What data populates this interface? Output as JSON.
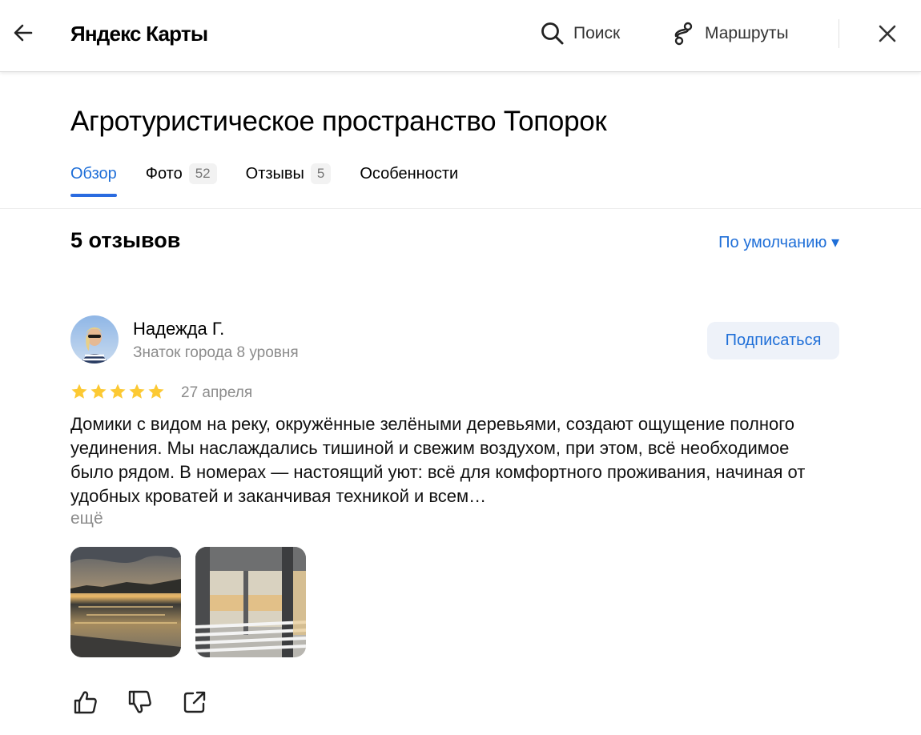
{
  "header": {
    "logo": "Яндекс Карты",
    "back_icon": "arrow-left-icon",
    "search_label": "Поиск",
    "routes_label": "Маршруты",
    "close_icon": "close-icon"
  },
  "organization": {
    "title": "Агротуристическое пространство Топорок"
  },
  "tabs": [
    {
      "label": "Обзор",
      "count": "",
      "active": true
    },
    {
      "label": "Фото",
      "count": "52",
      "active": false
    },
    {
      "label": "Отзывы",
      "count": "5",
      "active": false
    },
    {
      "label": "Особенности",
      "count": "",
      "active": false
    }
  ],
  "reviews": {
    "heading": "5 отзывов",
    "sort_label": "По умолчанию ▾"
  },
  "review": {
    "author_name": "Надежда Г.",
    "author_level": "Знаток города 8 уровня",
    "subscribe_label": "Подписаться",
    "rating": 5,
    "date": "27 апреля",
    "text": "Домики с видом на реку, окружённые зелёными деревьями, создают ощущение полного уединения. Мы наслаждались тишиной и свежим воздухом, при этом, всё необходимое было рядом. В номерах — настоящий уют: всё для комфортного проживания, начиная от удобных кроватей и заканчивая техникой и всем…",
    "more_label": "ещё"
  },
  "colors": {
    "accent": "#1f6fd8",
    "star": "#fcc933",
    "muted": "#8c8c8c"
  }
}
